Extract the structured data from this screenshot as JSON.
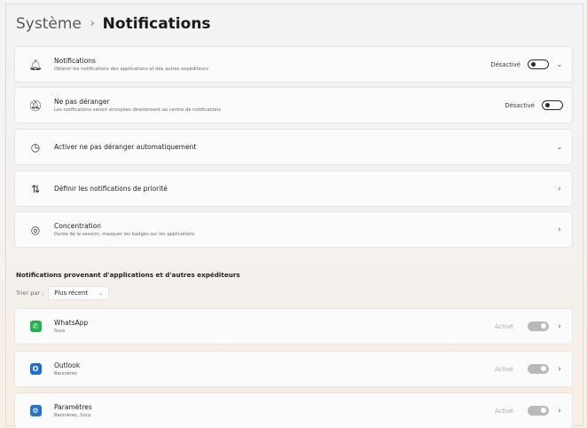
{
  "breadcrumb": {
    "parent": "Système",
    "separator": "›",
    "current": "Notifications"
  },
  "settings": [
    {
      "id": "notifications",
      "icon": "bell-icon",
      "glyph": "🔔︎",
      "title": "Notifications",
      "subtitle": "Obtenir les notifications des applications et des autres expéditeurs",
      "state": "Désactivé",
      "toggle": "off",
      "chevron": "⌄"
    },
    {
      "id": "dnd",
      "icon": "do-not-disturb-icon",
      "glyph": "🔕︎",
      "title": "Ne pas déranger",
      "subtitle": "Les notifications seront envoyées directement au centre de notifications",
      "state": "Désactivé",
      "toggle": "off",
      "chevron": ""
    },
    {
      "id": "auto-dnd",
      "icon": "clock-icon",
      "glyph": "◷",
      "title": "Activer ne pas déranger automatiquement",
      "subtitle": "",
      "state": "",
      "toggle": "",
      "chevron": "⌄"
    },
    {
      "id": "priority",
      "icon": "priority-sort-icon",
      "glyph": "⇅",
      "title": "Définir les notifications de priorité",
      "subtitle": "",
      "state": "",
      "toggle": "",
      "chevron": "›"
    },
    {
      "id": "focus",
      "icon": "focus-icon",
      "glyph": "◎",
      "title": "Concentration",
      "subtitle": "Durée de la session, masquer les badges sur les applications",
      "state": "",
      "toggle": "",
      "chevron": "›"
    }
  ],
  "apps_section": {
    "title": "Notifications provenant d'applications et d'autres expéditeurs",
    "sort_label": "Trier par :",
    "sort_value": "Plus récent",
    "sort_caret": "⌄"
  },
  "apps": [
    {
      "name": "WhatsApp",
      "subtitle": "Sons",
      "icon": "whatsapp-icon",
      "glyph": "✆",
      "state": "Activé",
      "toggle": "on",
      "chevron": "›"
    },
    {
      "name": "Outlook",
      "subtitle": "Bannières",
      "icon": "outlook-icon",
      "glyph": "O",
      "state": "Activé",
      "toggle": "on",
      "chevron": "›"
    },
    {
      "name": "Paramètres",
      "subtitle": "Bannières, Sons",
      "icon": "settings-gear-icon",
      "glyph": "⚙",
      "state": "Activé",
      "toggle": "on",
      "chevron": "›"
    }
  ]
}
